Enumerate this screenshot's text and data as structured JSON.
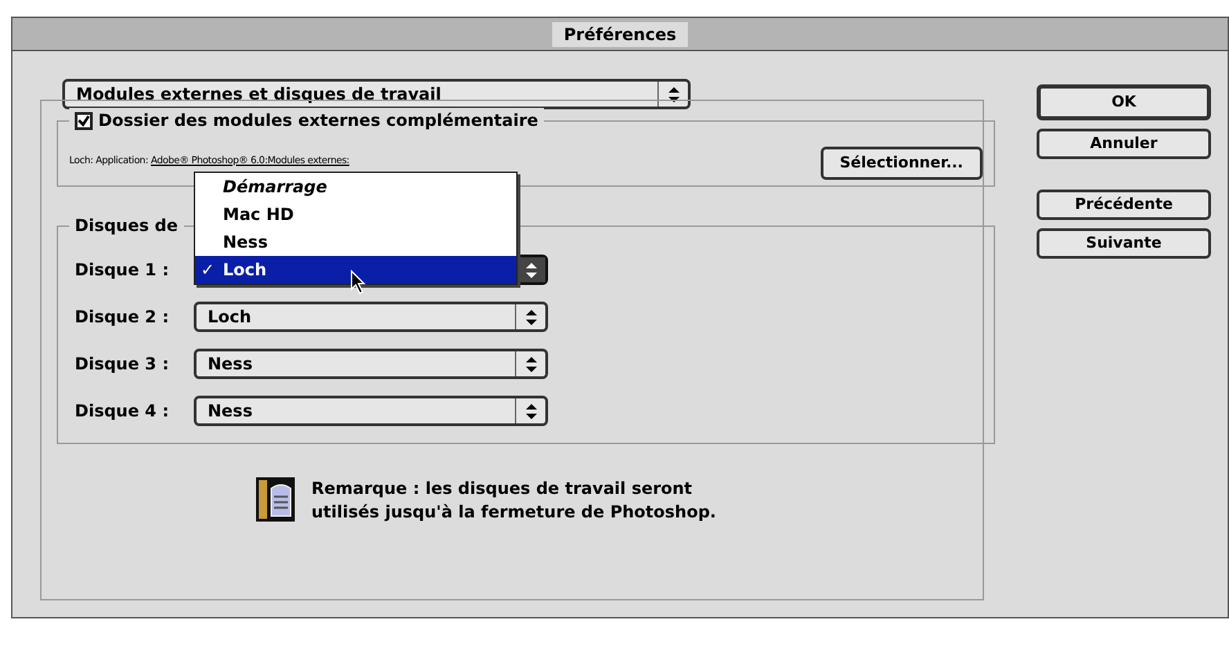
{
  "window": {
    "title": "Préférences"
  },
  "section_select": {
    "value": "Modules externes et disques de travail"
  },
  "plugins_folder": {
    "label": "Dossier des modules externes complémentaire",
    "checked": true,
    "path_prefix": "Loch: Application: ",
    "path": "Adobe® Photoshop® 6.0:Modules externes:",
    "button": "Sélectionner..."
  },
  "scratch_disks": {
    "title": "Disques de",
    "disks": [
      {
        "label": "Disque 1 :",
        "open": true
      },
      {
        "label": "Disque 2 :",
        "value": "Loch",
        "open": false
      },
      {
        "label": "Disque 3 :",
        "value": "Ness",
        "open": false
      },
      {
        "label": "Disque 4 :",
        "value": "Ness",
        "open": false
      }
    ],
    "menu": [
      {
        "label": "Démarrage",
        "kind": "startup",
        "selected": false
      },
      {
        "label": "Mac HD",
        "kind": "disk",
        "selected": false
      },
      {
        "label": "Ness",
        "kind": "disk",
        "selected": false
      },
      {
        "label": "Loch",
        "kind": "disk",
        "selected": true
      }
    ],
    "menu_check": "✓"
  },
  "note": {
    "lines": [
      "Remarque : les disques de travail seront",
      "utilisés jusqu'à la fermeture de Photoshop."
    ]
  },
  "buttons": [
    {
      "label": "OK",
      "default": true
    },
    {
      "label": "Annuler",
      "default": false
    },
    {
      "label": "Précédente",
      "default": false
    },
    {
      "label": "Suivante",
      "default": false
    }
  ]
}
